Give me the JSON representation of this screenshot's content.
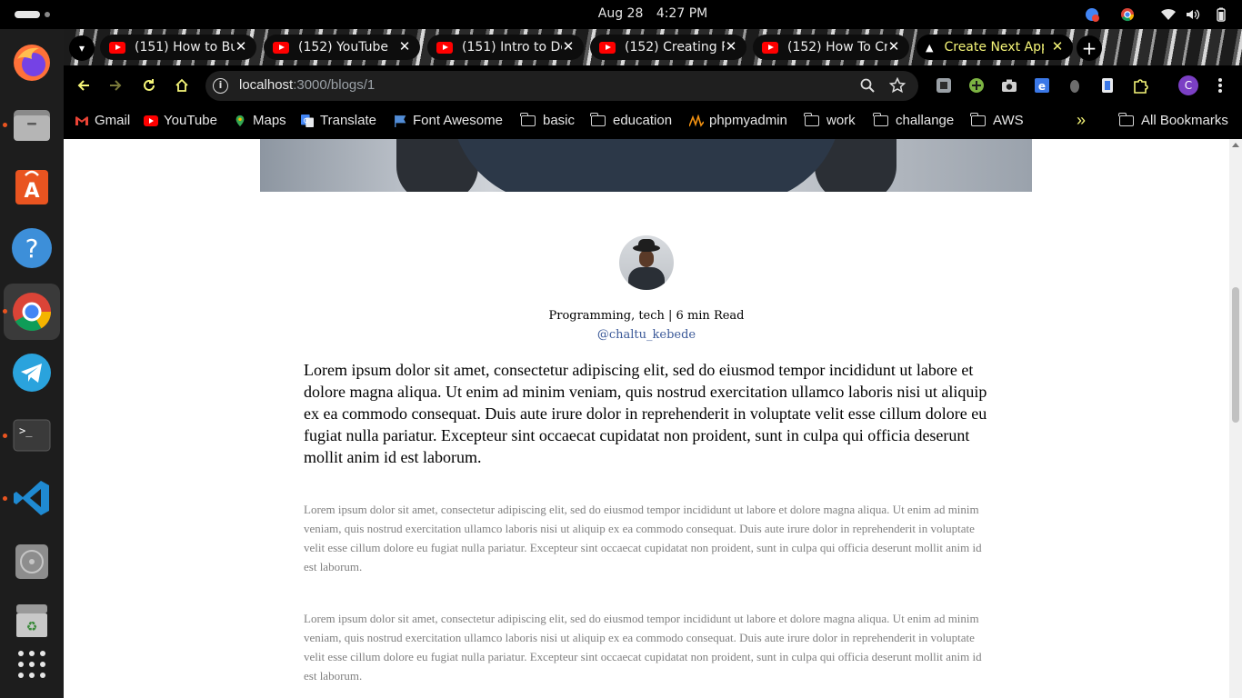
{
  "system": {
    "date": "Aug 28",
    "time": "4:27 PM"
  },
  "dock": {
    "apps": [
      "firefox",
      "files",
      "app-center",
      "help",
      "chrome",
      "telegram",
      "terminal",
      "vscode",
      "disk-utility",
      "trash",
      "show-apps"
    ]
  },
  "tabs": [
    {
      "label": "(151) How to Bu",
      "icon": "youtube-icon"
    },
    {
      "label": "(152) YouTube",
      "icon": "youtube-icon"
    },
    {
      "label": "(151) Intro to De",
      "icon": "youtube-icon"
    },
    {
      "label": "(152) Creating P",
      "icon": "youtube-icon"
    },
    {
      "label": "(152) How To Cr",
      "icon": "youtube-icon"
    },
    {
      "label": "Create Next App",
      "icon": "triangle-icon",
      "active": true
    }
  ],
  "tab_close": "✕",
  "new_tab": "+",
  "address": {
    "host": "localhost",
    "path": ":3000/blogs/1"
  },
  "bookmarks": [
    {
      "label": "Gmail",
      "icon": "gmail-icon"
    },
    {
      "label": "YouTube",
      "icon": "youtube-icon"
    },
    {
      "label": "Maps",
      "icon": "maps-icon"
    },
    {
      "label": "Translate",
      "icon": "translate-icon"
    },
    {
      "label": "Font Awesome",
      "icon": "flag-icon"
    },
    {
      "label": "basic",
      "icon": "folder-icon"
    },
    {
      "label": "education",
      "icon": "folder-icon"
    },
    {
      "label": "phpmyadmin",
      "icon": "phpmyadmin-icon"
    },
    {
      "label": "work",
      "icon": "folder-icon"
    },
    {
      "label": "challange",
      "icon": "folder-icon"
    },
    {
      "label": "AWS",
      "icon": "folder-icon"
    }
  ],
  "bookmarks_overflow": "»",
  "all_bookmarks": "All Bookmarks",
  "profile_initial": "C",
  "blog": {
    "meta": "Programming, tech | 6 min Read",
    "author": "@chaltu_kebede",
    "lead": "Lorem ipsum dolor sit amet, consectetur adipiscing elit, sed do eiusmod tempor incididunt ut labore et dolore magna aliqua. Ut enim ad minim veniam, quis nostrud exercitation ullamco laboris nisi ut aliquip ex ea commodo consequat. Duis aute irure dolor in reprehenderit in voluptate velit esse cillum dolore eu fugiat nulla pariatur. Excepteur sint occaecat cupidatat non proident, sunt in culpa qui officia deserunt mollit anim id est laborum.",
    "paragraphs": [
      "Lorem ipsum dolor sit amet, consectetur adipiscing elit, sed do eiusmod tempor incididunt ut labore et dolore magna aliqua. Ut enim ad minim veniam, quis nostrud exercitation ullamco laboris nisi ut aliquip ex ea commodo consequat. Duis aute irure dolor in reprehenderit in voluptate velit esse cillum dolore eu fugiat nulla pariatur. Excepteur sint occaecat cupidatat non proident, sunt in culpa qui officia deserunt mollit anim id est laborum.",
      "Lorem ipsum dolor sit amet, consectetur adipiscing elit, sed do eiusmod tempor incididunt ut labore et dolore magna aliqua. Ut enim ad minim veniam, quis nostrud exercitation ullamco laboris nisi ut aliquip ex ea commodo consequat. Duis aute irure dolor in reprehenderit in voluptate velit esse cillum dolore eu fugiat nulla pariatur. Excepteur sint occaecat cupidatat non proident, sunt in culpa qui officia deserunt mollit anim id est laborum."
    ]
  },
  "colors": {
    "active_tab_text": "#f5f578",
    "author_link": "#3b5998",
    "muted_text": "#808080"
  }
}
